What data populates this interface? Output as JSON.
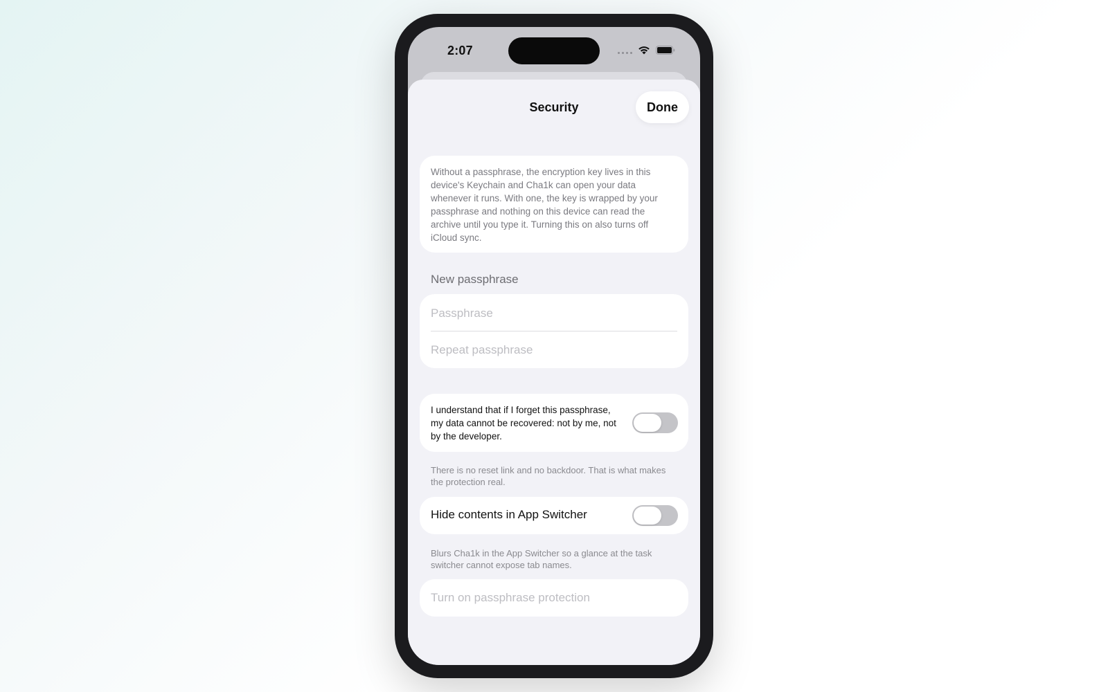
{
  "status_bar": {
    "time": "2:07"
  },
  "nav": {
    "title": "Security",
    "done_label": "Done"
  },
  "info": {
    "text": "Without a passphrase, the encryption key lives in this device's Keychain and Cha1k can open your data whenever it runs. With one, the key is wrapped by your passphrase and nothing on this device can read the archive until you type it. Turning this on also turns off iCloud sync."
  },
  "new_passphrase": {
    "header": "New passphrase",
    "passphrase_placeholder": "Passphrase",
    "passphrase_value": "",
    "repeat_placeholder": "Repeat passphrase",
    "repeat_value": ""
  },
  "acknowledge": {
    "text": "I understand that if I forget this passphrase, my data cannot be recovered: not by me, not by the developer.",
    "toggle_on": false,
    "footnote": "There is no reset link and no backdoor. That is what makes the protection real."
  },
  "app_switcher": {
    "label": "Hide contents in App Switcher",
    "toggle_on": false,
    "footnote": "Blurs Cha1k in the App Switcher so a glance at the task switcher cannot expose tab names."
  },
  "action": {
    "label": "Turn on passphrase protection",
    "enabled": false
  },
  "colors": {
    "sheet_background": "#f2f2f7",
    "toggle_off": "#c4c4c8",
    "disabled_text": "#bdbdc2"
  },
  "icons": {
    "signal": "cellular-signal-icon",
    "wifi": "wifi-icon",
    "battery": "battery-icon"
  }
}
